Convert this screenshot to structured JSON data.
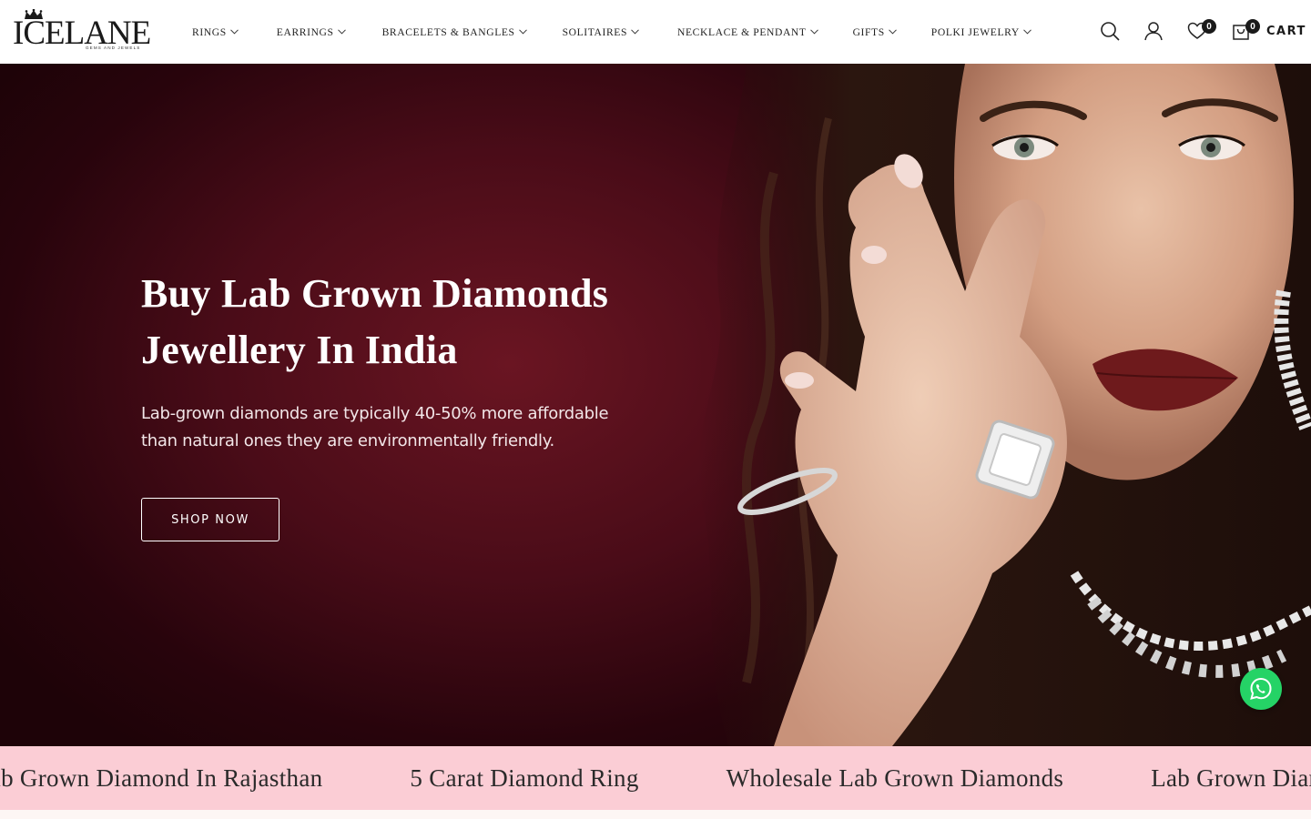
{
  "brand": {
    "name": "ICELANE",
    "tagline": "GEMS AND JEWELS"
  },
  "nav": {
    "items": [
      {
        "label": "RINGS",
        "name": "nav-item-rings"
      },
      {
        "label": "EARRINGS",
        "name": "nav-item-earrings"
      },
      {
        "label": "BRACELETS & BANGLES",
        "name": "nav-item-bracelets-bangles"
      },
      {
        "label": "SOLITAIRES",
        "name": "nav-item-solitaires"
      },
      {
        "label": "NECKLACE & PENDANT",
        "name": "nav-item-necklace-pendant"
      },
      {
        "label": "GIFTS",
        "name": "nav-item-gifts"
      },
      {
        "label": "POLKI JEWELRY",
        "name": "nav-item-polki-jewelry"
      }
    ]
  },
  "header_actions": {
    "wishlist_count": "0",
    "cart_count": "0",
    "cart_label": "CART"
  },
  "hero": {
    "title_line1": "Buy Lab Grown Diamonds",
    "title_line2": "Jewellery In India",
    "subtitle_line1": "Lab-grown diamonds are typically 40-50% more affordable",
    "subtitle_line2": "than natural ones they are environmentally friendly.",
    "cta_label": "SHOP NOW"
  },
  "marquee": {
    "items": [
      "Lab Grown Diamond In Rajasthan",
      "5 Carat Diamond Ring",
      "Wholesale Lab Grown Diamonds",
      "Lab Grown Diamonds"
    ]
  },
  "colors": {
    "hero_bg": "#4a0c18",
    "marquee_bg": "#fbcdd5",
    "whatsapp": "#25d366",
    "text_dark": "#1a1a1a"
  },
  "icons": [
    "crown-icon",
    "search-icon",
    "account-icon",
    "wishlist-heart-icon",
    "cart-bag-icon",
    "chevron-down-icon",
    "whatsapp-icon"
  ]
}
